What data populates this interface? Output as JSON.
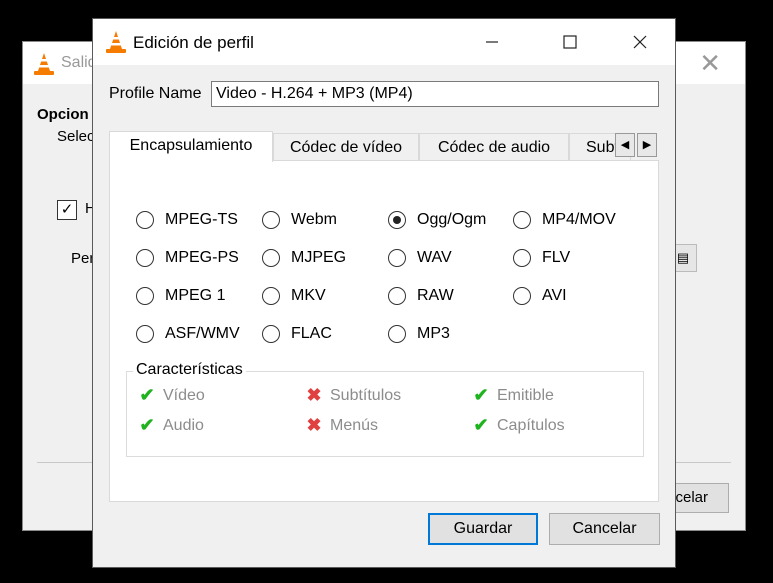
{
  "background_window": {
    "title": "Salid",
    "options_heading": "Opcion",
    "select_label": "Selec",
    "checkbox_label": "H",
    "profile_label": "Per",
    "cancel_label": "celar"
  },
  "dialog": {
    "title": "Edición de perfil",
    "profile_name_label": "Profile Name",
    "profile_name_value": "Video - H.264 + MP3 (MP4)",
    "tabs": [
      {
        "label": "Encapsulamiento"
      },
      {
        "label": "Códec de vídeo"
      },
      {
        "label": "Códec de audio"
      },
      {
        "label": "Subtítulos"
      }
    ],
    "formats": [
      {
        "label": "MPEG-TS",
        "selected": false
      },
      {
        "label": "Webm",
        "selected": false
      },
      {
        "label": "Ogg/Ogm",
        "selected": true
      },
      {
        "label": "MP4/MOV",
        "selected": false
      },
      {
        "label": "MPEG-PS",
        "selected": false
      },
      {
        "label": "MJPEG",
        "selected": false
      },
      {
        "label": "WAV",
        "selected": false
      },
      {
        "label": "FLV",
        "selected": false
      },
      {
        "label": "MPEG 1",
        "selected": false
      },
      {
        "label": "MKV",
        "selected": false
      },
      {
        "label": "RAW",
        "selected": false
      },
      {
        "label": "AVI",
        "selected": false
      },
      {
        "label": "ASF/WMV",
        "selected": false
      },
      {
        "label": "FLAC",
        "selected": false
      },
      {
        "label": "MP3",
        "selected": false
      }
    ],
    "features_title": "Características",
    "features": [
      {
        "label": "Vídeo",
        "supported": true
      },
      {
        "label": "Subtítulos",
        "supported": false
      },
      {
        "label": "Emitible",
        "supported": true
      },
      {
        "label": "Audio",
        "supported": true
      },
      {
        "label": "Menús",
        "supported": false
      },
      {
        "label": "Capítulos",
        "supported": true
      }
    ],
    "save_label": "Guardar",
    "cancel_label": "Cancelar"
  },
  "icons": {
    "ok": "✔",
    "no": "✖",
    "scroll_left": "◀",
    "scroll_right": "▶",
    "check": "✓"
  },
  "colors": {
    "accent": "#0078d7",
    "ok": "#1fb31f",
    "no": "#e04040",
    "cone": "#f57c00"
  }
}
